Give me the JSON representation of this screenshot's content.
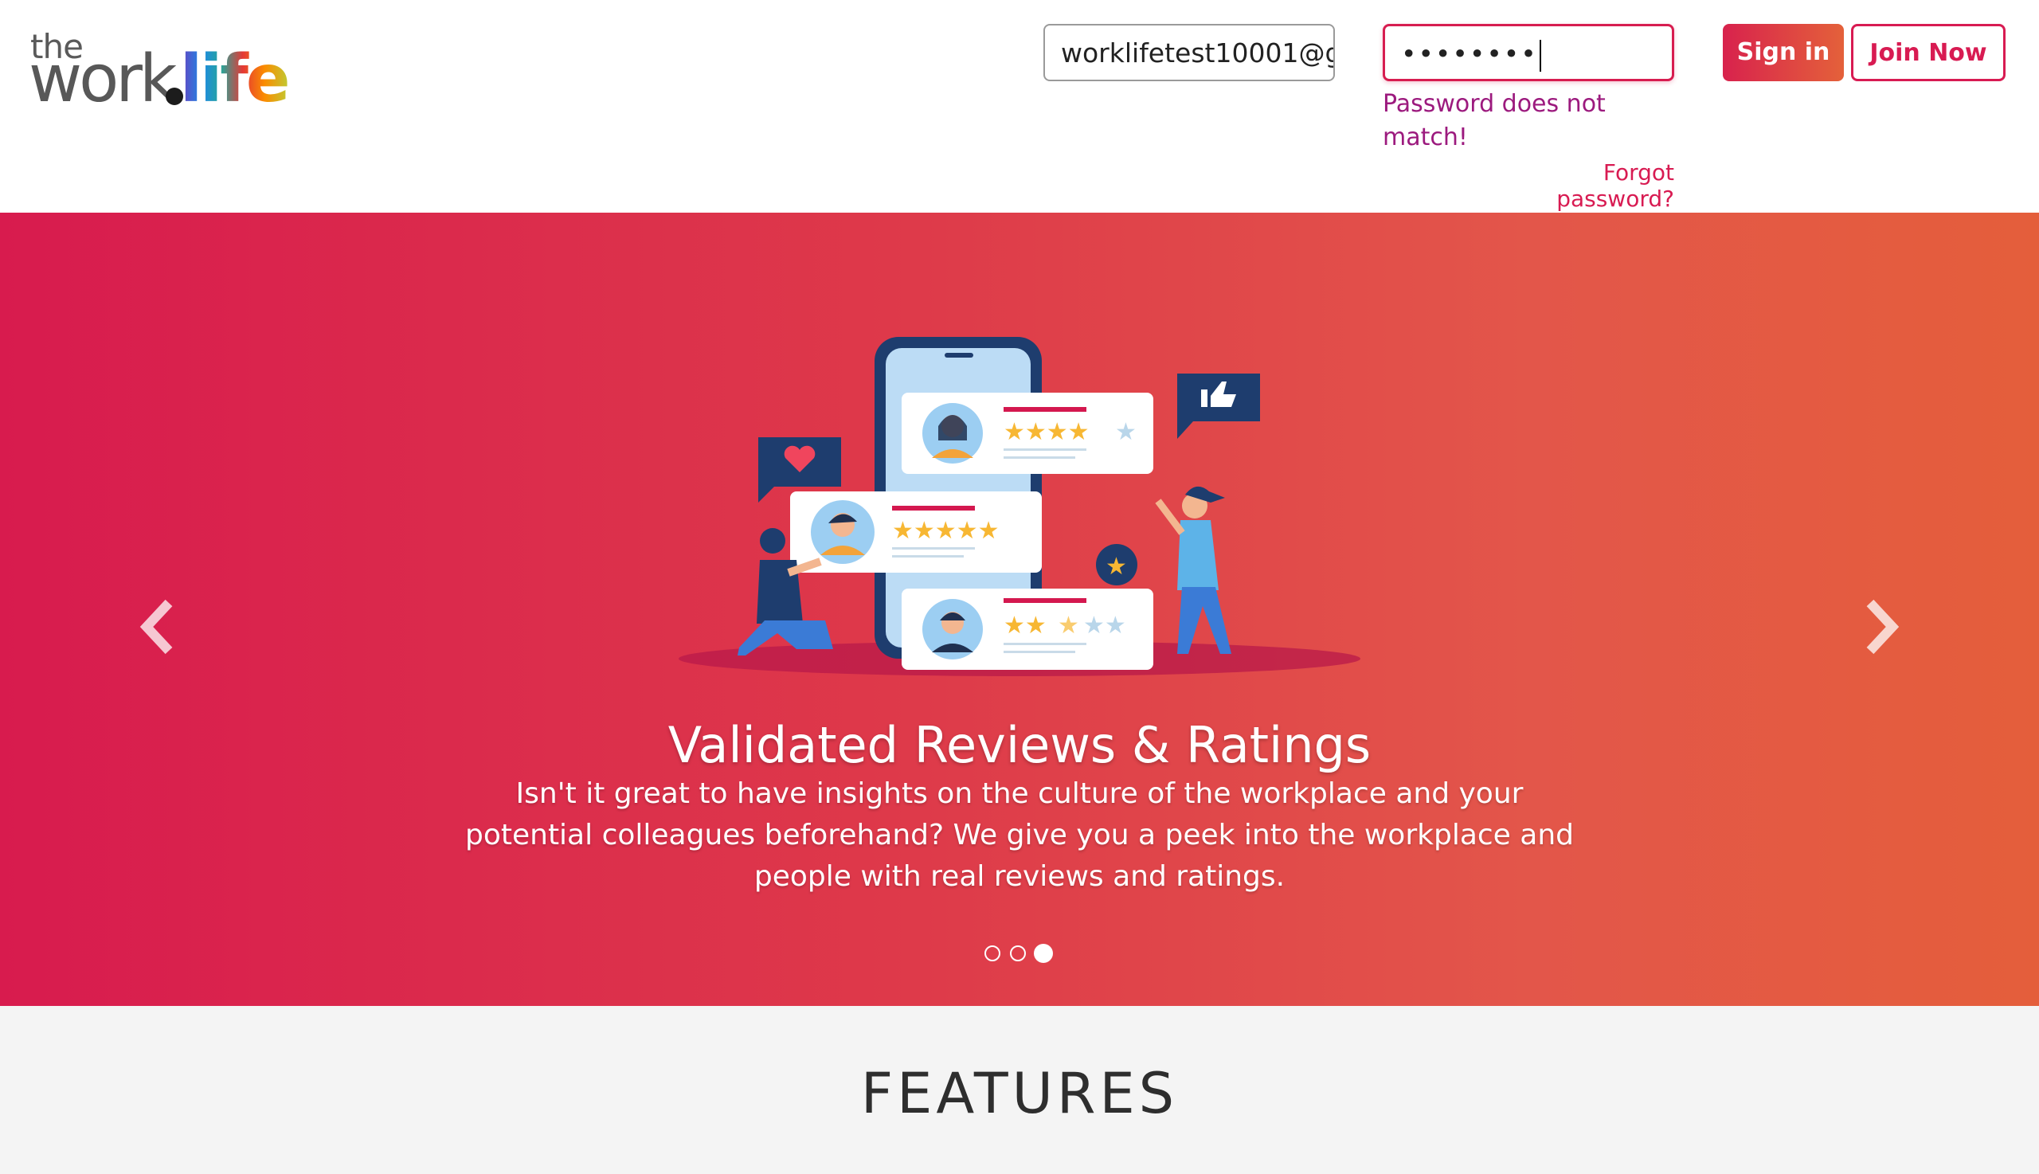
{
  "header": {
    "logo": {
      "the": "the",
      "work": "work",
      "life": "life"
    },
    "email_value": "worklifetest10001@g",
    "password_value": "••••••••",
    "password_error": "Password does not match!",
    "forgot_password": "Forgot password?",
    "signin_label": "Sign in",
    "join_label": "Join Now"
  },
  "hero": {
    "active_slide": 3,
    "slide_count": 3,
    "title": "Validated Reviews & Ratings",
    "text": "Isn't it great to have insights on the culture of the workplace and your potential colleagues beforehand? We give you a peek into the workplace and people with real reviews and ratings.",
    "prev_icon": "chevron-left-icon",
    "next_icon": "chevron-right-icon"
  },
  "features": {
    "title": "FEATURES"
  },
  "colors": {
    "brand_pink": "#d81b52",
    "brand_orange": "#e4613a",
    "error_purple": "#9c1a7e"
  }
}
